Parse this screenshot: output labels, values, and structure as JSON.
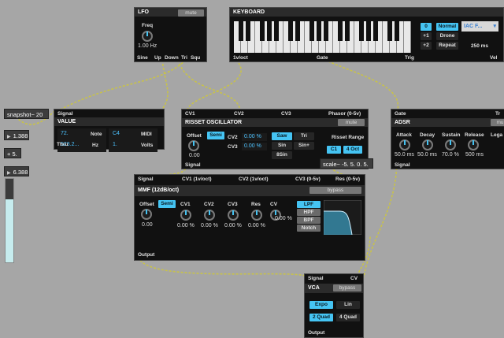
{
  "snapshot": {
    "label": "snapshot~ 20"
  },
  "numboxes": [
    "1.388",
    "+ 5.",
    "6.388"
  ],
  "scale": {
    "label": "scale~ -5. 5. 0. 5."
  },
  "lfo": {
    "title": "LFO",
    "mute": "mute",
    "freq_label": "Freq",
    "freq_value": "1.00 Hz",
    "outputs": [
      "Sine",
      "Up",
      "Down",
      "Tri",
      "Squ"
    ]
  },
  "keyboard": {
    "title": "KEYBOARD",
    "octave_value": "0",
    "octave_plus1": "+1",
    "octave_plus2": "+2",
    "mode": "Normal",
    "drone": "Drone",
    "repeat": "Repeat",
    "device": "IAC F...",
    "repeat_ms": "250 ms",
    "outputs": [
      "1v/oct",
      "Gate",
      "Trig",
      "Vel"
    ]
  },
  "value": {
    "title": "VALUE",
    "inlet": "Signal",
    "outlet": "Thru",
    "note_val": "72.",
    "note_lbl": "Note",
    "midi_val": "C4",
    "midi_lbl": "MIDI",
    "hz_val": "523.2...",
    "hz_lbl": "Hz",
    "volts_val": "1.",
    "volts_lbl": "Volts"
  },
  "risset": {
    "title": "RISSET OSCILLATOR",
    "mute": "mute",
    "inlets": [
      "CV1",
      "CV2",
      "CV3",
      "Phasor (0-5v)"
    ],
    "offset_label": "Offset",
    "semi": "Semi",
    "offset_value": "0.00",
    "cv2_label": "CV2",
    "cv2_value": "0.00 %",
    "cv3_label": "CV3",
    "cv3_value": "0.00 %",
    "waves": [
      "Saw",
      "Tri",
      "Sin",
      "Sin+",
      "8Sin"
    ],
    "range_label": "Risset Range",
    "range_low": "C1",
    "range_high": "4 Oct",
    "outlet": "Signal"
  },
  "adsr": {
    "title": "ADSR",
    "mute": "mu",
    "inlet": "Gate",
    "inlet2": "Tr",
    "knobs": [
      {
        "label": "Attack",
        "value": "50.0 ms"
      },
      {
        "label": "Decay",
        "value": "50.0 ms"
      },
      {
        "label": "Sustain",
        "value": "70.0 %"
      },
      {
        "label": "Release",
        "value": "500 ms"
      }
    ],
    "legato": "Lega",
    "outlet": "Signal"
  },
  "mmf": {
    "title": "MMF (12dB/oct)",
    "bypass": "bypass",
    "inlets": [
      "Signal",
      "CV1 (1v/oct)",
      "CV2 (1v/oct)",
      "CV3 (0-5v)",
      "Res (0-5v)"
    ],
    "offset_label": "Offset",
    "semi": "Semi",
    "offset_value": "0.00",
    "knobs": [
      {
        "label": "CV1",
        "value": "0.00 %"
      },
      {
        "label": "CV2",
        "value": "0.00 %"
      },
      {
        "label": "CV3",
        "value": "0.00 %"
      },
      {
        "label": "Res",
        "value": "0.00 %"
      },
      {
        "label": "CV",
        "value": "0.00 %"
      }
    ],
    "types": [
      "LPF",
      "HPF",
      "BPF",
      "Notch"
    ],
    "outlet": "Output"
  },
  "vca": {
    "title": "VCA",
    "bypass": "bypass",
    "inlets": [
      "Signal",
      "CV"
    ],
    "expo": "Expo",
    "lin": "Lin",
    "quad2": "2 Quad",
    "quad4": "4 Quad",
    "outlet": "Output"
  },
  "colors": {
    "accent": "#45c4f3",
    "panel": "#111111",
    "canvas": "#a6a6a6",
    "cable": "#c8c24a"
  }
}
